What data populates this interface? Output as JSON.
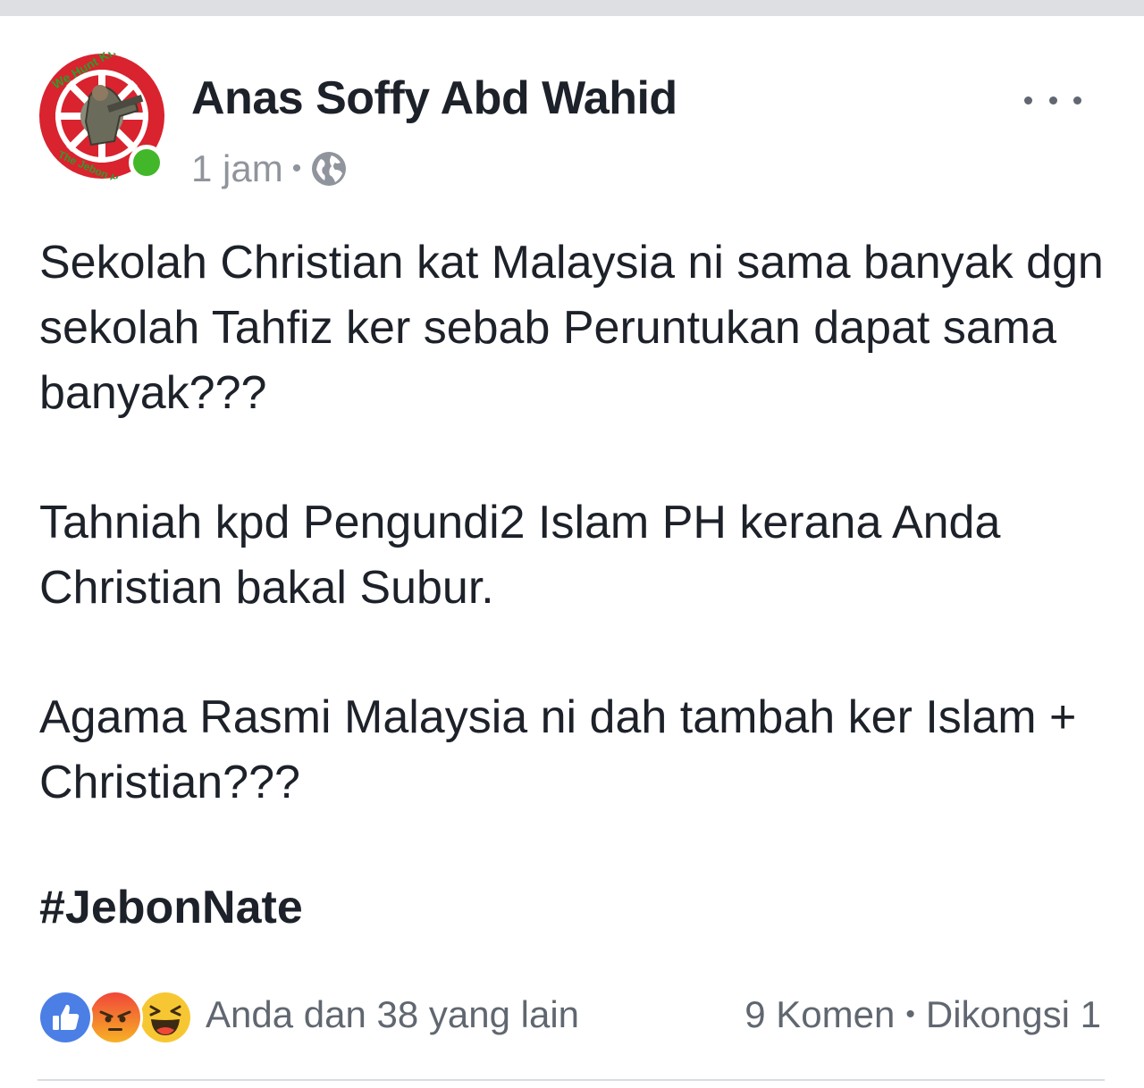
{
  "post": {
    "author": "Anas Soffy Abd Wahid",
    "timestamp": "1 jam",
    "meta_separator": "•",
    "privacy_icon": "globe-icon",
    "avatar_icon": "profile-avatar",
    "avatar_text_top": "We Hunt Khadam",
    "avatar_text_bottom": "The Jebon H",
    "online_status_color": "#42b72a",
    "more_icon": "more-options-icon",
    "paragraphs": [
      "Sekolah Christian kat Malaysia ni sama banyak dgn sekolah Tahfiz ker sebab Peruntukan dapat sama banyak???",
      "Tahniah kpd Pengundi2 Islam PH kerana Anda Christian bakal Subur.",
      "Agama Rasmi Malaysia ni dah tambah ker Islam + Christian???"
    ],
    "hashtag": "#JebonNate"
  },
  "footer": {
    "reaction_icons": [
      "like-icon",
      "angry-icon",
      "haha-icon"
    ],
    "reaction_summary": "Anda dan 38 yang lain",
    "comments": "9 Komen",
    "separator": "•",
    "shares": "Dikongsi 1"
  },
  "colors": {
    "like_blue": "#4267b2",
    "angry_red": "#e9710f",
    "haha_yellow": "#f7b125",
    "meta_grey": "#90949c",
    "text": "#1d2129"
  }
}
